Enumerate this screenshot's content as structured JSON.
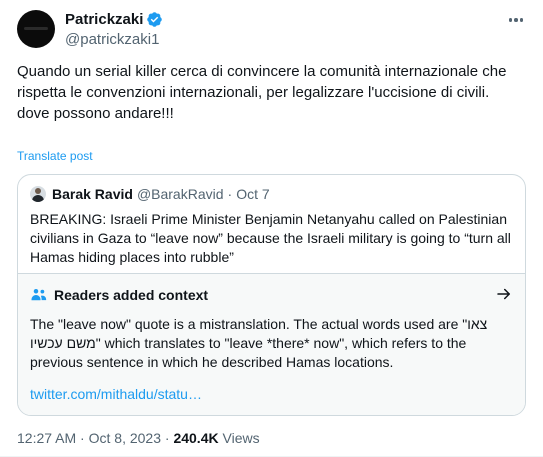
{
  "author": {
    "display_name": "Patrickzaki",
    "handle": "@patrickzaki1",
    "verified": true
  },
  "icons": {
    "more": "more-horizontal-icon",
    "verified": "verified-badge-icon",
    "readers": "people-icon",
    "arrow": "arrow-right-icon"
  },
  "colors": {
    "link": "#1d9bf0",
    "verified": "#1d9bf0",
    "secondary_text": "#536471"
  },
  "tweet": {
    "text": "Quando un serial killer cerca di convincere la comunità internazionale che rispetta le convenzioni internazionali, per legalizzare l'uccisione di civili.\ndove possono andare!!!",
    "translate_label": "Translate post"
  },
  "quote": {
    "author_name": "Barak Ravid",
    "author_handle": "@BarakRavid",
    "separator": "·",
    "date": "Oct 7",
    "text": "BREAKING: Israeli Prime Minister Benjamin Netanyahu called on Palestinian civilians in Gaza to “leave now” because the Israeli military is going to “turn all Hamas hiding places into rubble”"
  },
  "context": {
    "title": "Readers added context",
    "body": "The \"leave now\" quote is a mistranslation. The actual words used are \"צאו משם עכשיו\" which translates to \"leave *there* now\", which refers to the previous sentence in which he described Hamas locations.",
    "link": "twitter.com/mithaldu/statu…"
  },
  "meta": {
    "time": "12:27 AM",
    "separator": "·",
    "date": "Oct 8, 2023",
    "separator2": "·",
    "views_count": "240.4K",
    "views_label": "Views"
  }
}
